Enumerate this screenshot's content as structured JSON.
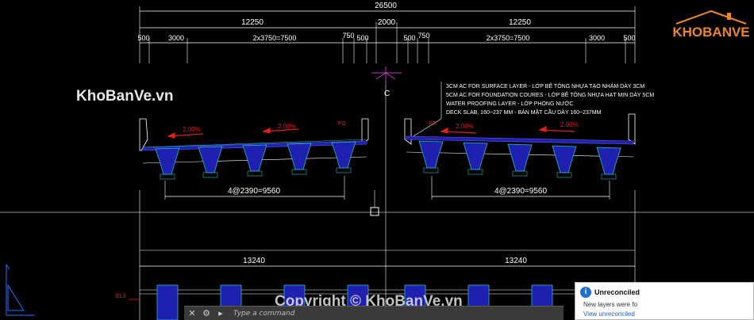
{
  "dimensions": {
    "total": "26500",
    "half_left": "12250",
    "median": "2000",
    "half_right": "12250",
    "row_left": [
      "500",
      "3000",
      "2x3750=7500",
      "750",
      "500"
    ],
    "row_right": [
      "500",
      "750",
      "2x3750=7500",
      "3000",
      "500"
    ],
    "girder_left": "4@2390=9560",
    "girder_right": "4@2390=9560",
    "deck_left": "13240",
    "deck_right": "13240"
  },
  "slopes": [
    "2.00%",
    "2.00%",
    "2.00%",
    "2.00%"
  ],
  "fg_labels": [
    "FG",
    "FG"
  ],
  "centerline_label": "C",
  "level_label": "EL3",
  "notes": [
    "3CM AC FOR SURFACE LAYER - LỚP BÊ TÔNG NHỰA TẠO NHÁM DÀY 3CM",
    "5CM AC FOR FOUNDATION COURES - LỚP BÊ TÔNG NHỰA HẠT MỊN DÀY 5CM",
    "WATER PROOFING LAYER - LỚP PHÒNG NƯỚC",
    "DECK SLAB, 160~237 MM - BẢN MẶT CẦU DÀY 160~237MM"
  ],
  "watermarks": {
    "top_left": "KhoBanVe.vn",
    "bottom": "Copyright © KhoBanVe.vn"
  },
  "logo_text": "KHOBANVE",
  "command": {
    "placeholder": "Type a command"
  },
  "notification": {
    "title": "Unreconciled",
    "body": "New layers were fo",
    "link": "View unreconciled"
  },
  "colors": {
    "background": "#000000",
    "dimension_line": "#ffffff",
    "girder": "#20c0c0",
    "deck_fill": "#2020b0",
    "slope_arrow": "#e02020",
    "note_text": "#ffffff",
    "centerline_mark": "#c040c0"
  }
}
